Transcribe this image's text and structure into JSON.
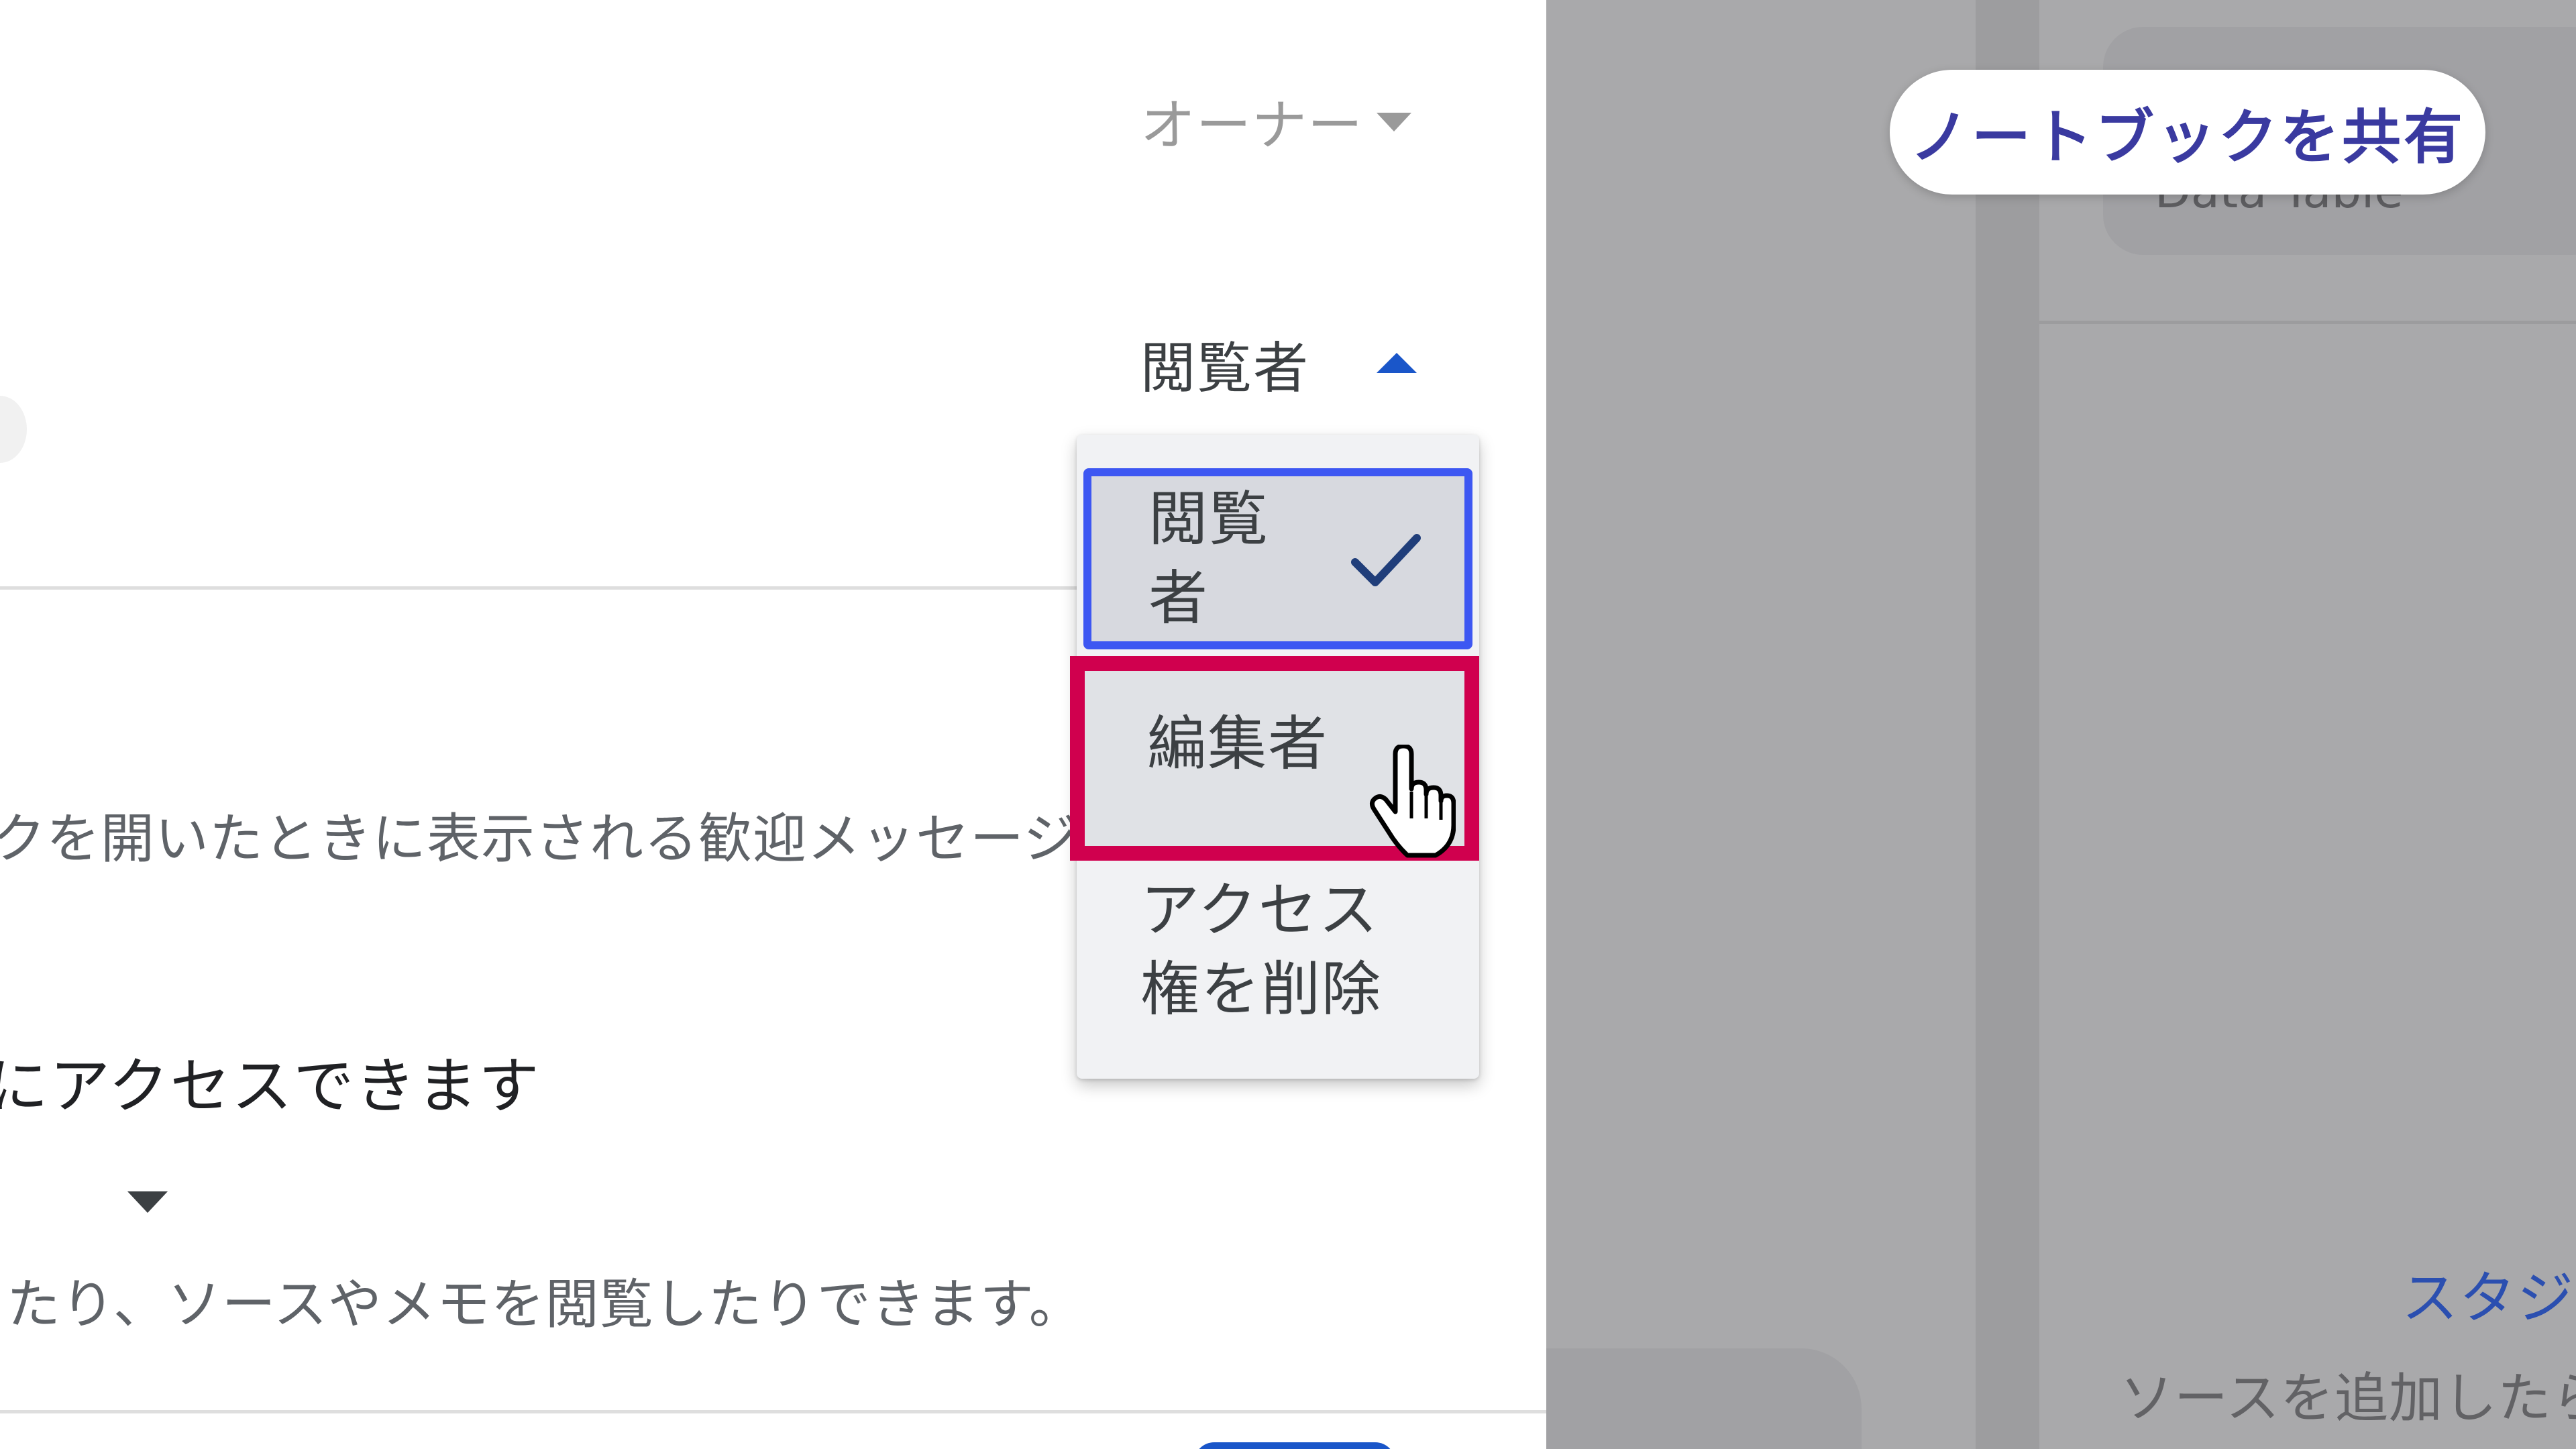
{
  "dialog": {
    "owner_role_label": "オーナー",
    "viewer_role_label": "閲覧者",
    "welcome_description_fragment": "クを開いたときに表示される歓迎メッセージ",
    "access_heading_fragment": "にアクセスできます",
    "access_description_fragment": "たり、ソースやメモを閲覧したりできます。"
  },
  "role_menu": {
    "items": [
      {
        "label": "閲覧者",
        "selected": true
      },
      {
        "label": "編集者",
        "selected": false,
        "highlighted": true
      },
      {
        "label": "アクセス権を削除",
        "selected": false
      }
    ]
  },
  "background": {
    "share_button_label": "ノートブックを共有",
    "data_table_label": "Data Table",
    "studio_label": "スタジオ",
    "add_source_hint": "ソースを追加したら"
  },
  "colors": {
    "selected_outline": "#3d57f2",
    "highlight_outline": "#d0004e",
    "caret_blue": "#1a56c9"
  }
}
